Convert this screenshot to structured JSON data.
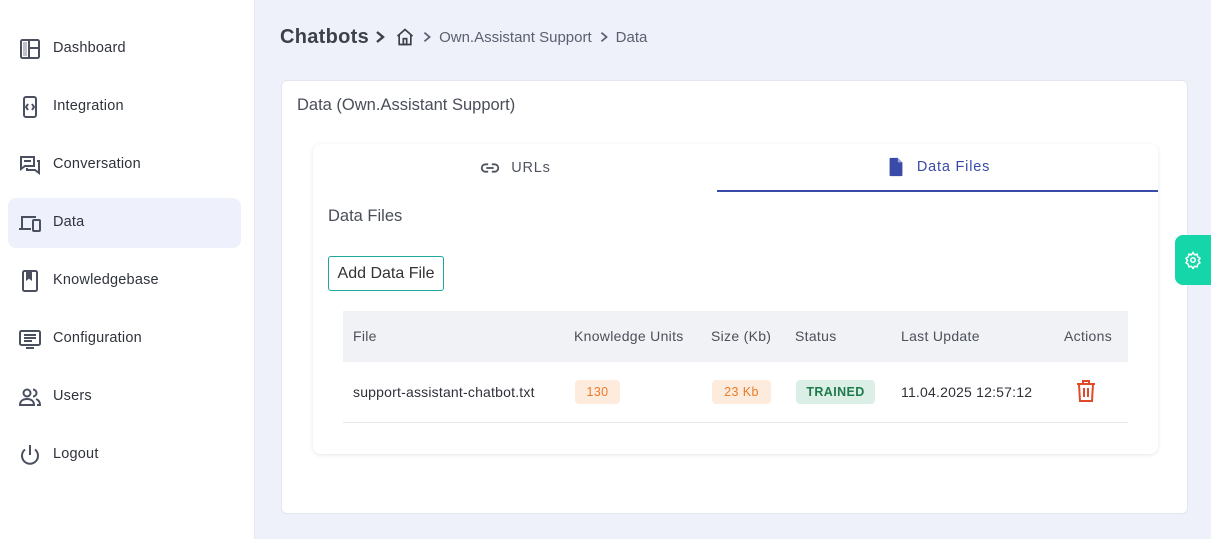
{
  "sidebar": {
    "items": [
      {
        "label": "Dashboard",
        "icon": "dashboard-icon"
      },
      {
        "label": "Integration",
        "icon": "integration-icon"
      },
      {
        "label": "Conversation",
        "icon": "conversation-icon"
      },
      {
        "label": "Data",
        "icon": "devices-icon",
        "active": true
      },
      {
        "label": "Knowledgebase",
        "icon": "book-icon"
      },
      {
        "label": "Configuration",
        "icon": "configuration-icon"
      },
      {
        "label": "Users",
        "icon": "users-icon"
      },
      {
        "label": "Logout",
        "icon": "power-icon"
      }
    ]
  },
  "breadcrumb": {
    "root": "Chatbots",
    "home_icon": "home-icon",
    "items": [
      "Own.Assistant Support",
      "Data"
    ]
  },
  "card": {
    "title": "Data (Own.Assistant Support)"
  },
  "tabs": [
    {
      "label": "URLs",
      "icon": "link-icon"
    },
    {
      "label": "Data Files",
      "icon": "file-icon",
      "active": true
    }
  ],
  "section": {
    "title": "Data Files",
    "add_button": "Add Data File"
  },
  "table": {
    "headers": [
      "File",
      "Knowledge Units",
      "Size (Kb)",
      "Status",
      "Last Update",
      "Actions"
    ],
    "rows": [
      {
        "file": "support-assistant-chatbot.txt",
        "knowledge_units": "130",
        "size": "23 Kb",
        "status": "TRAINED",
        "last_update": "11.04.2025 12:57:12",
        "action_icon": "trash-icon"
      }
    ]
  },
  "fab": {
    "icon": "gear-icon"
  },
  "colors": {
    "accent": "#3a4aa8",
    "teal": "#1ea7a0",
    "fab": "#15d6a8",
    "orange_chip_bg": "#fdebdd",
    "orange_chip_text": "#ec7a26",
    "green_chip_bg": "#dcefe6",
    "green_chip_text": "#1f7a4b",
    "danger": "#e04a2b",
    "background": "#eef1f9"
  }
}
